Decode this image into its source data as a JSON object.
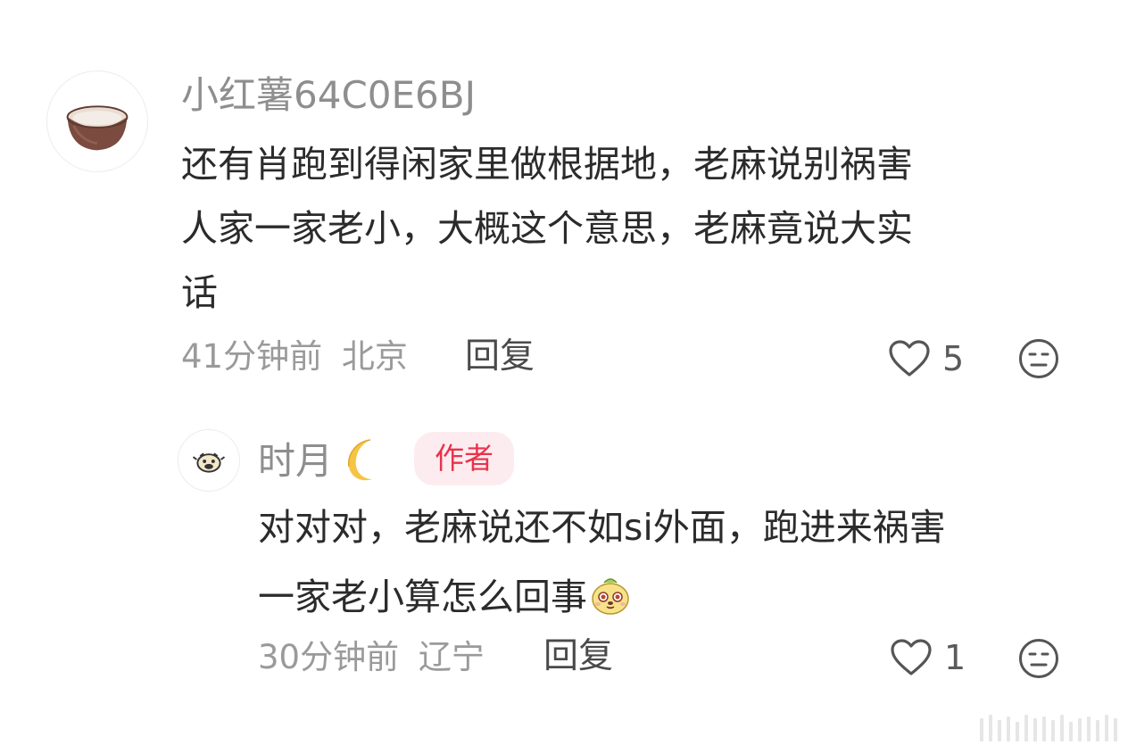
{
  "comments": [
    {
      "username": "小红薯64C0E6BJ",
      "avatar_icon": "bowl-icon",
      "text_lines": [
        "还有肖跑到得闲家里做根据地，老麻说别祸害",
        "人家一家老小，大概这个意思，老麻竟说大实",
        "话"
      ],
      "time": "41分钟前",
      "location": "北京",
      "reply_label": "回复",
      "likes": "5",
      "reply": {
        "username": "时月",
        "username_emoji": "crescent-moon-emoji",
        "avatar_icon": "cartoon-face-icon",
        "badge": "作者",
        "text_lines": [
          "对对对，老麻说还不如si外面，跑进来祸害",
          "一家老小算怎么回事"
        ],
        "trailing_emoji": "cute-dog-emoji",
        "time": "30分钟前",
        "location": "辽宁",
        "reply_label": "回复",
        "likes": "1"
      }
    }
  ],
  "colors": {
    "username": "#8e8e8e",
    "text": "#2b2b2b",
    "meta": "#9a9a9a",
    "badge_bg": "#fdecef",
    "badge_text": "#e8334d"
  }
}
